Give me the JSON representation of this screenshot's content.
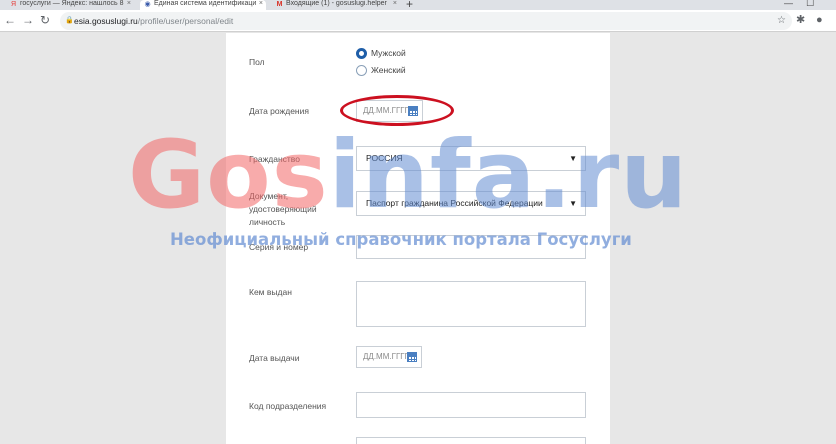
{
  "browser": {
    "tabs": [
      {
        "favicon": "Я",
        "title": "госуслуги — Яндекс: нашлось 8",
        "active": false
      },
      {
        "favicon": "◉",
        "title": "Единая система идентификаци",
        "active": true
      },
      {
        "favicon": "M",
        "title": "Входящие (1) - gosuslugi.helper",
        "active": false
      }
    ],
    "new_tab": "+",
    "window_controls": {
      "minimize": "—",
      "maximize": "☐"
    },
    "url_host": "esia.gosuslugi.ru",
    "url_path": "/profile/user/personal/edit"
  },
  "form": {
    "gender": {
      "label": "Пол",
      "options": [
        {
          "label": "Мужской",
          "checked": true
        },
        {
          "label": "Женский",
          "checked": false
        }
      ]
    },
    "birth_date": {
      "label": "Дата рождения",
      "placeholder": "ДД.ММ.ГГГГ"
    },
    "citizenship": {
      "label": "Гражданство",
      "value": "РОССИЯ"
    },
    "document": {
      "label_lines": [
        "Документ,",
        "удостоверяющий",
        "личность"
      ],
      "value": "Паспорт гражданина Российской Федерации"
    },
    "series_number": {
      "label": "Серия и номер"
    },
    "issued_by": {
      "label": "Кем выдан"
    },
    "issue_date": {
      "label": "Дата выдачи",
      "placeholder": "ДД.ММ.ГГГГ"
    },
    "division_code": {
      "label": "Код подразделения"
    }
  },
  "watermark": {
    "part1": "Gos",
    "part2": "infa.ru",
    "subtitle": "Неофициальный справочник портала Госуслуги"
  },
  "colors": {
    "highlight": "#cc1020",
    "radio_checked": "#1f5ea8",
    "watermark_red": "#f26666",
    "watermark_blue": "#628cd2"
  }
}
